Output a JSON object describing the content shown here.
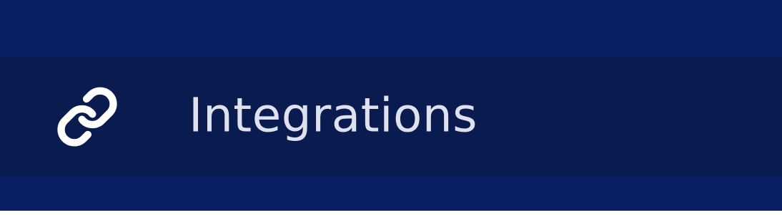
{
  "colors": {
    "sidebar_background": "#0b2064",
    "active_item_background": "#0a1b4f",
    "label_text": "#dfe2ee",
    "icon": "#ffffff"
  },
  "sidebar": {
    "items": [
      {
        "label": "Integrations",
        "icon": "link-icon",
        "active": true
      }
    ]
  }
}
